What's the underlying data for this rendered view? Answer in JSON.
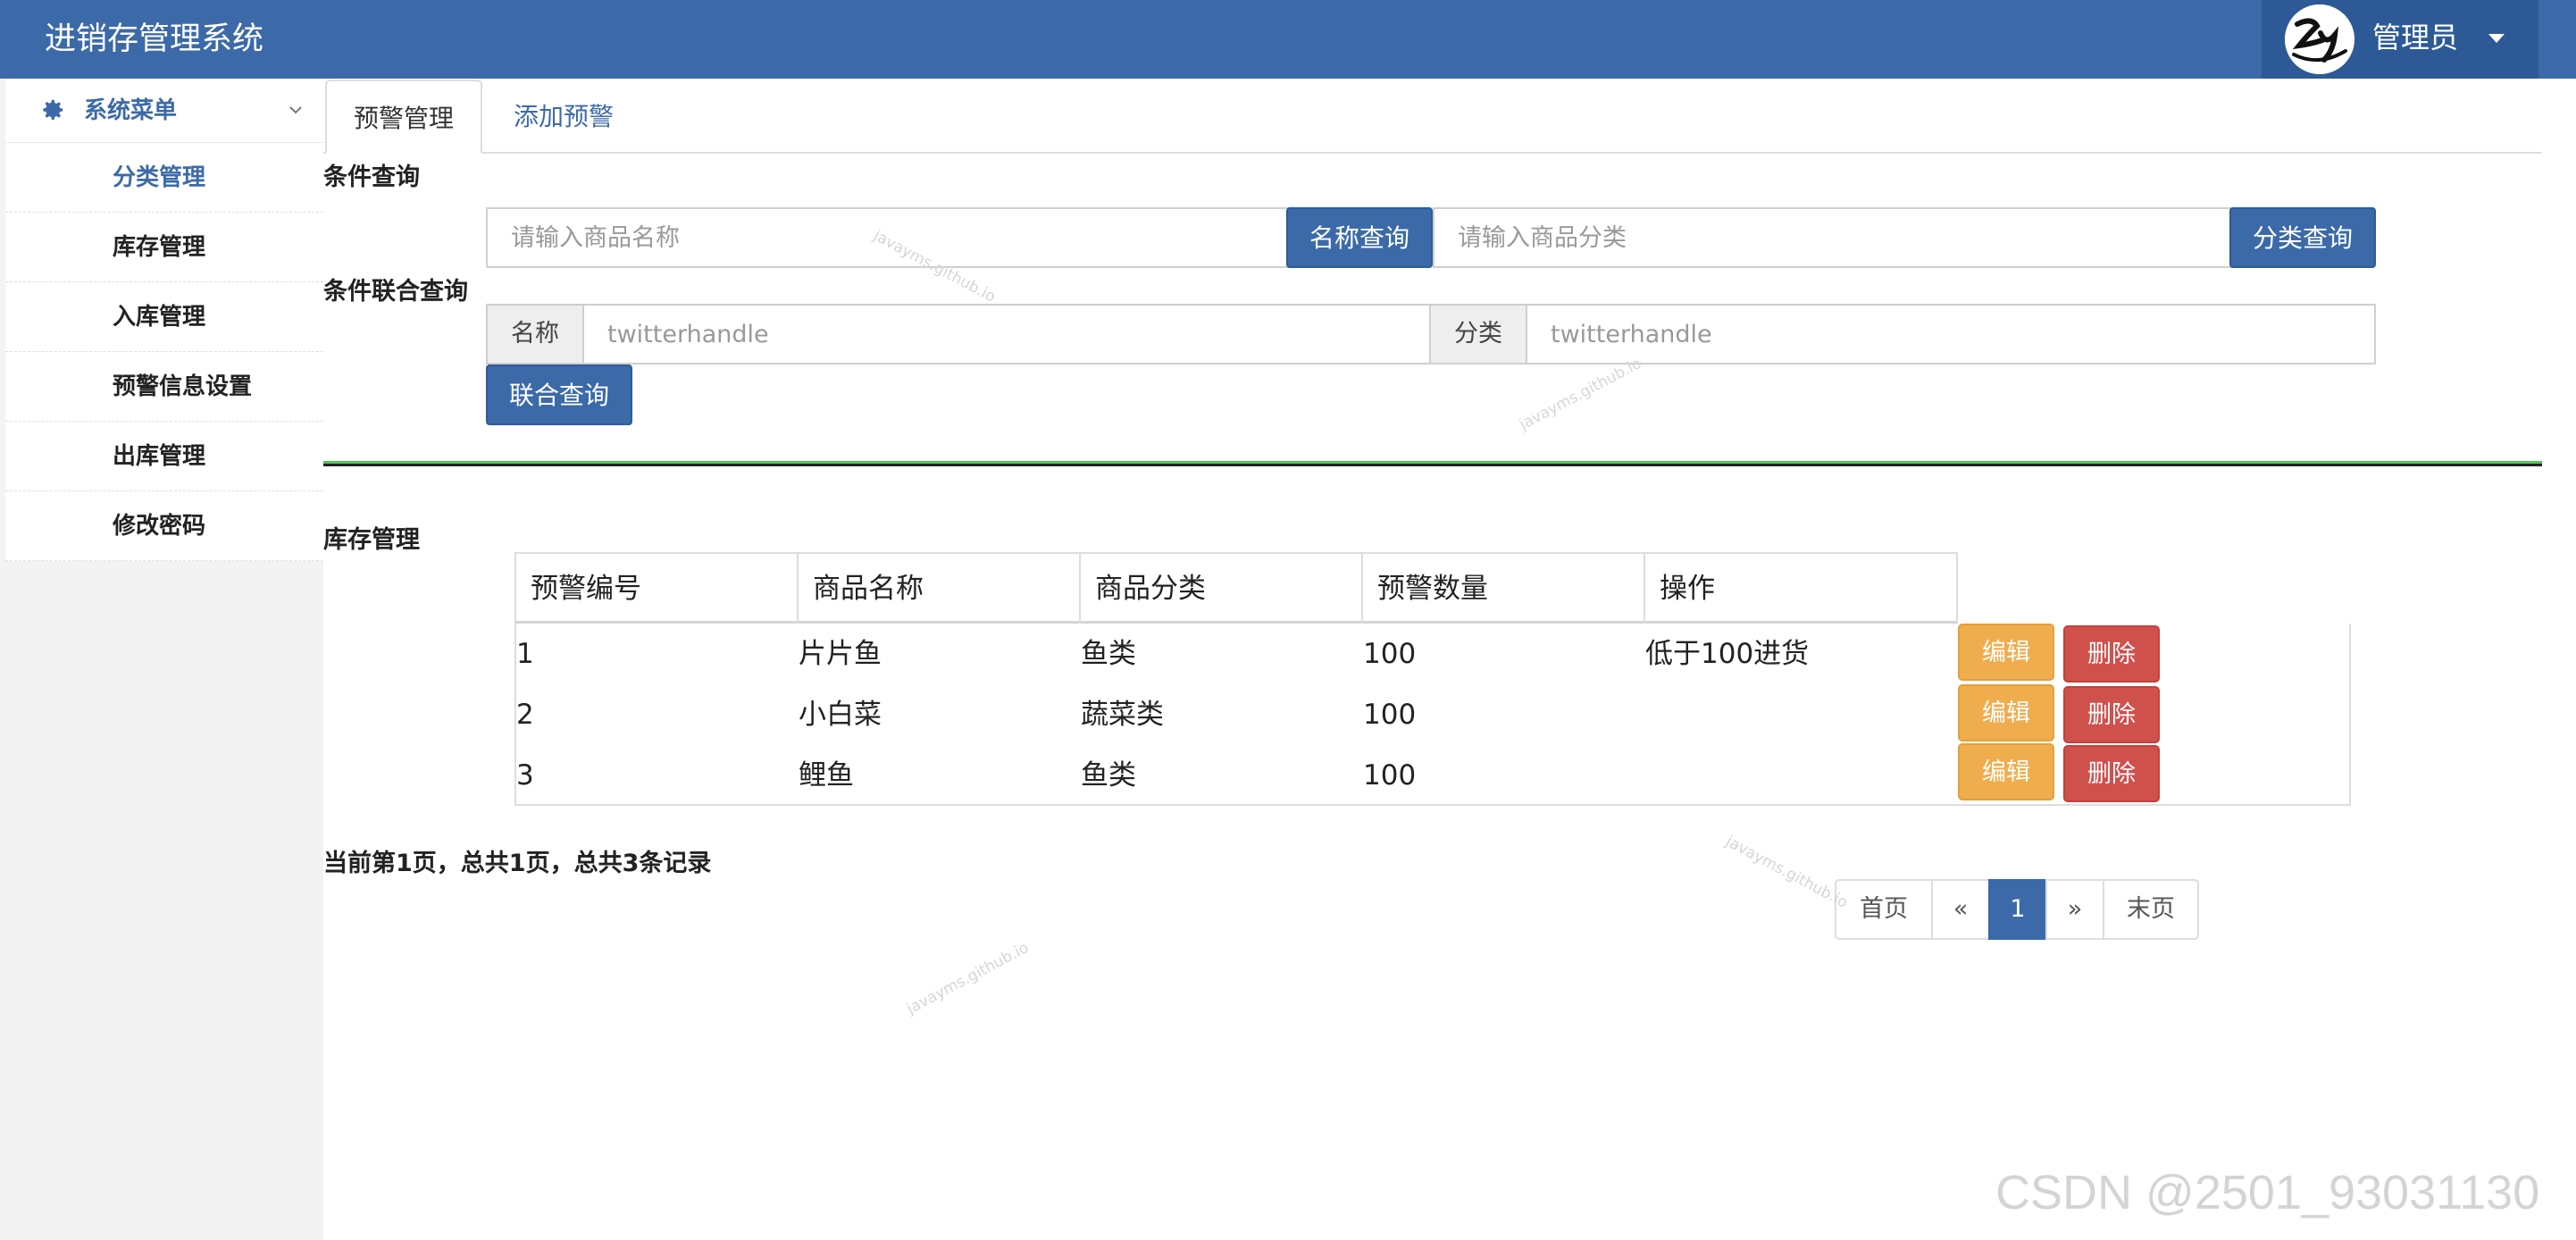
{
  "header": {
    "title": "进销存管理系统",
    "user_name": "管理员"
  },
  "sidebar": {
    "menu_title": "系统菜单",
    "items": [
      {
        "label": "分类管理"
      },
      {
        "label": "库存管理"
      },
      {
        "label": "入库管理"
      },
      {
        "label": "预警信息设置"
      },
      {
        "label": "出库管理"
      },
      {
        "label": "修改密码"
      }
    ]
  },
  "tabs": [
    {
      "label": "预警管理"
    },
    {
      "label": "添加预警"
    }
  ],
  "query": {
    "title": "条件查询",
    "name_placeholder": "请输入商品名称",
    "name_button": "名称查询",
    "category_placeholder": "请输入商品分类",
    "category_button": "分类查询"
  },
  "combined_query": {
    "title": "条件联合查询",
    "name_label": "名称",
    "name_placeholder": "twitterhandle",
    "category_label": "分类",
    "category_placeholder": "twitterhandle",
    "button": "联合查询"
  },
  "table": {
    "title": "库存管理",
    "columns": [
      "预警编号",
      "商品名称",
      "商品分类",
      "预警数量",
      "操作"
    ],
    "rows": [
      {
        "id": "1",
        "name": "片片鱼",
        "category": "鱼类",
        "quantity": "100",
        "note": "低于100进货"
      },
      {
        "id": "2",
        "name": "小白菜",
        "category": "蔬菜类",
        "quantity": "100",
        "note": ""
      },
      {
        "id": "3",
        "name": "鲤鱼",
        "category": "鱼类",
        "quantity": "100",
        "note": ""
      }
    ],
    "edit_label": "编辑",
    "delete_label": "删除"
  },
  "pagination": {
    "summary": "当前第1页，总共1页，总共3条记录",
    "first": "首页",
    "prev": "«",
    "current": "1",
    "next": "»",
    "last": "末页"
  },
  "watermarks": {
    "text": "javayms.github.io",
    "credit": "CSDN @2501_93031130"
  }
}
